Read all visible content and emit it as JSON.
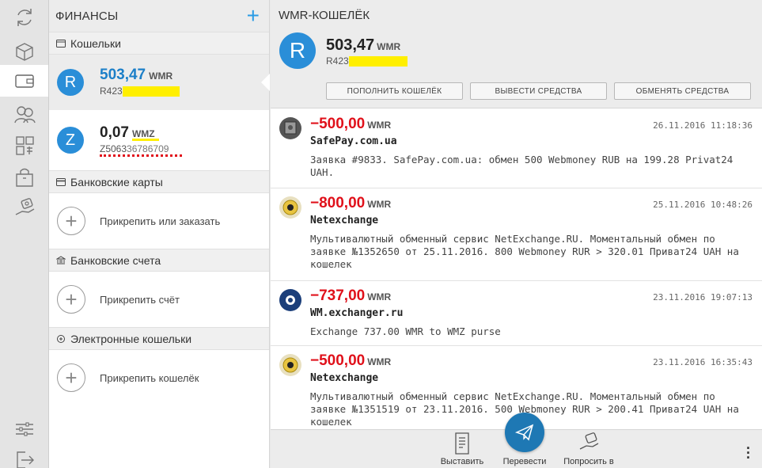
{
  "finance": {
    "title": "ФИНАНСЫ",
    "add_icon": "plus-icon",
    "sections": {
      "wallets": "Кошельки",
      "bank_cards": "Банковские карты",
      "bank_accounts": "Банковские счета",
      "e_wallets": "Электронные кошельки"
    },
    "wallets": [
      {
        "letter": "R",
        "amount": "503,47",
        "currency": "WMR",
        "id_prefix": "R423"
      },
      {
        "letter": "Z",
        "amount": "0,07",
        "currency": "WMZ",
        "id_prefix": "Z5063"
      }
    ],
    "attach": {
      "card": "Прикрепить или заказать",
      "account": "Прикрепить счёт",
      "ewallet": "Прикрепить кошелёк"
    }
  },
  "main": {
    "title": "WMR-КОШЕЛЁК",
    "letter": "R",
    "amount": "503,47",
    "currency": "WMR",
    "id_prefix": "R423",
    "actions": {
      "topup": "ПОПОЛНИТЬ КОШЕЛЁК",
      "withdraw": "ВЫВЕСТИ СРЕДСТВА",
      "exchange": "ОБМЕНЯТЬ СРЕДСТВА"
    },
    "transactions": [
      {
        "amount": "−500,00",
        "currency": "WMR",
        "date": "26.11.2016 11:18:36",
        "name": "SafePay.com.ua",
        "desc": "Заявка #9833. SafePay.com.ua: обмен 500 Webmoney RUB на 199.28 Privat24 UAH."
      },
      {
        "amount": "−800,00",
        "currency": "WMR",
        "date": "25.11.2016 10:48:26",
        "name": "Netexchange",
        "desc": "Мультивалютный обменный сервис NetExchange.RU. Моментальный обмен по заявке №1352650 от 25.11.2016. 800 Webmoney RUR > 320.01 Приват24 UAH на кошелек"
      },
      {
        "amount": "−737,00",
        "currency": "WMR",
        "date": "23.11.2016 19:07:13",
        "name": "WM.exchanger.ru",
        "desc": "Exchange 737.00 WMR to WMZ purse"
      },
      {
        "amount": "−500,00",
        "currency": "WMR",
        "date": "23.11.2016 16:35:43",
        "name": "Netexchange",
        "desc": "Мультивалютный обменный сервис NetExchange.RU. Моментальный обмен по заявке №1351519 от 23.11.2016. 500 Webmoney RUR > 200.41 Приват24 UAH на кошелек"
      }
    ]
  },
  "bottom": {
    "invoice": "Выставить",
    "transfer": "Перевести",
    "request": "Попросить в"
  },
  "colors": {
    "accent": "#2a8ed8",
    "negative": "#e0101a",
    "highlight": "#ffef00"
  }
}
